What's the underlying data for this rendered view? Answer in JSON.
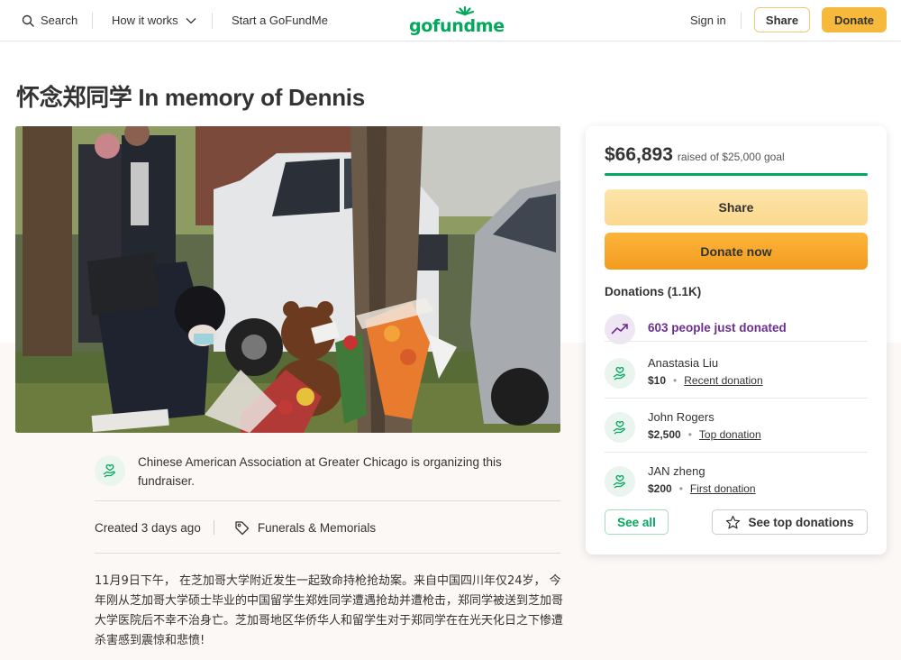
{
  "header": {
    "search_label": "Search",
    "how_it_works_label": "How it works",
    "start_label": "Start a GoFundMe",
    "logo_text": "gofundme",
    "signin_label": "Sign in",
    "share_label": "Share",
    "donate_label": "Donate"
  },
  "campaign": {
    "title": "怀念郑同学 In memory of Dennis",
    "organizer_text": "Chinese American Association at Greater Chicago is organizing this fundraiser.",
    "created": "Created 3 days ago",
    "category": "Funerals & Memorials",
    "story": "11月9日下午， 在芝加哥大学附近发生一起致命持枪抢劫案。来自中国四川年仅24岁， 今年刚从芝加哥大学硕士毕业的中国留学生郑姓同学遭遇抢劫并遭枪击，郑同学被送到芝加哥大学医院后不幸不治身亡。芝加哥地区华侨华人和留学生对于郑同学在在光天化日之下惨遭杀害感到震惊和悲愤!"
  },
  "donation_card": {
    "raised": "$66,893",
    "goal_text": "raised of $25,000 goal",
    "progress": 1.0,
    "share_label": "Share",
    "donate_now_label": "Donate now",
    "donations_heading": "Donations (1.1K)",
    "trend_text": "603 people just donated",
    "donors": [
      {
        "name": "Anastasia Liu",
        "amount": "$10",
        "type": "Recent donation"
      },
      {
        "name": "John Rogers",
        "amount": "$2,500",
        "type": "Top donation"
      },
      {
        "name": "JAN zheng",
        "amount": "$200",
        "type": "First donation"
      }
    ],
    "see_all_label": "See all",
    "see_top_label": "See top donations"
  },
  "colors": {
    "brand_green": "#02a95c",
    "donate_orange": "#f29c1f",
    "share_yellow": "#fbd88e",
    "trend_purple": "#6b2f8f"
  },
  "icons": [
    "search-icon",
    "chevron-down-icon",
    "logo-sun-icon",
    "tag-icon",
    "heart-hand-icon",
    "trend-up-icon",
    "star-icon"
  ]
}
